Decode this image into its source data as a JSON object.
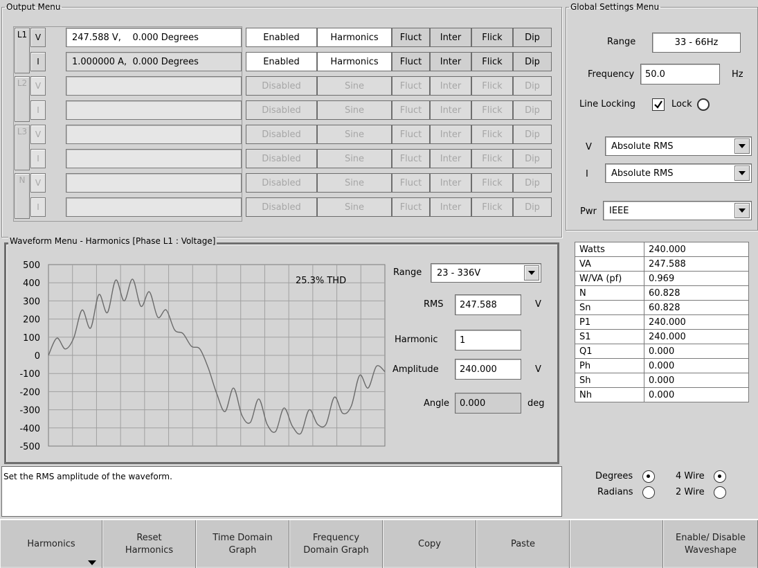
{
  "output_menu": {
    "title": "Output Menu",
    "groups": [
      {
        "phase": "L1",
        "enabled": true,
        "rows": [
          {
            "type": "V",
            "value": "247.588 V,    0.000 Degrees",
            "state": "Enabled",
            "mode": "Harmonics"
          },
          {
            "type": "I",
            "value": "1.000000 A,  0.000 Degrees",
            "state": "Enabled",
            "mode": "Harmonics"
          }
        ]
      },
      {
        "phase": "L2",
        "enabled": false,
        "rows": [
          {
            "type": "V",
            "value": "",
            "state": "Disabled",
            "mode": "Sine"
          },
          {
            "type": "I",
            "value": "",
            "state": "Disabled",
            "mode": "Sine"
          }
        ]
      },
      {
        "phase": "L3",
        "enabled": false,
        "rows": [
          {
            "type": "V",
            "value": "",
            "state": "Disabled",
            "mode": "Sine"
          },
          {
            "type": "I",
            "value": "",
            "state": "Disabled",
            "mode": "Sine"
          }
        ]
      },
      {
        "phase": "N",
        "enabled": false,
        "rows": [
          {
            "type": "V",
            "value": "",
            "state": "Disabled",
            "mode": "Sine"
          },
          {
            "type": "I",
            "value": "",
            "state": "Disabled",
            "mode": "Sine"
          }
        ]
      }
    ],
    "row_buttons": [
      "Fluct",
      "Inter",
      "Flick",
      "Dip"
    ]
  },
  "waveform_menu": {
    "title": "Waveform Menu - Harmonics [Phase L1 : Voltage]",
    "thd_label": "25.3% THD",
    "range_label": "Range",
    "range_value": "23 - 336V",
    "rms_label": "RMS",
    "rms_value": "247.588",
    "rms_unit": "V",
    "harmonic_label": "Harmonic",
    "harmonic_value": "1",
    "amplitude_label": "Amplitude",
    "amplitude_value": "240.000",
    "amplitude_unit": "V",
    "angle_label": "Angle",
    "angle_value": "0.000",
    "angle_unit": "deg"
  },
  "chart_data": {
    "type": "line",
    "title": "",
    "annotation": "25.3% THD",
    "xlabel": "",
    "ylabel": "",
    "ylim": [
      -500,
      500
    ],
    "y_ticks": [
      "500",
      "400",
      "300",
      "200",
      "100",
      "0",
      "-100",
      "-200",
      "-300",
      "-400",
      "-500"
    ],
    "grid": true,
    "series": [
      {
        "x": [
          0,
          0.025,
          0.05,
          0.075,
          0.1,
          0.125,
          0.15,
          0.175,
          0.2,
          0.225,
          0.25,
          0.275,
          0.3,
          0.325,
          0.35,
          0.375,
          0.4,
          0.425,
          0.45,
          0.475,
          0.5,
          0.525,
          0.55,
          0.575,
          0.6,
          0.625,
          0.65,
          0.675,
          0.7,
          0.725,
          0.75,
          0.775,
          0.8,
          0.825,
          0.85,
          0.875,
          0.9,
          0.925,
          0.95,
          0.975,
          1
        ],
        "values": [
          0,
          95,
          35,
          95,
          250,
          150,
          335,
          235,
          415,
          300,
          420,
          270,
          350,
          210,
          250,
          140,
          120,
          50,
          35,
          -70,
          -210,
          -310,
          -180,
          -330,
          -370,
          -240,
          -380,
          -420,
          -290,
          -390,
          -430,
          -300,
          -380,
          -380,
          -230,
          -320,
          -280,
          -110,
          -180,
          -60,
          -90
        ]
      }
    ]
  },
  "status": {
    "message": "Set the RMS amplitude of the waveform."
  },
  "global_settings": {
    "title": "Global Settings Menu",
    "range_label": "Range",
    "range_value": "33 - 66Hz",
    "frequency_label": "Frequency",
    "frequency_value": "50.0",
    "frequency_unit": "Hz",
    "line_locking_label": "Line Locking",
    "lock_label": "Lock",
    "v_label": "V",
    "v_mode": "Absolute RMS",
    "i_label": "I",
    "i_mode": "Absolute RMS",
    "pwr_label": "Pwr",
    "pwr_mode": "IEEE",
    "measurements": [
      {
        "name": "Watts",
        "value": "240.000"
      },
      {
        "name": "VA",
        "value": "247.588"
      },
      {
        "name": "W/VA (pf)",
        "value": "0.969"
      },
      {
        "name": "N",
        "value": "60.828"
      },
      {
        "name": "Sn",
        "value": "60.828"
      },
      {
        "name": "P1",
        "value": "240.000"
      },
      {
        "name": "S1",
        "value": "240.000"
      },
      {
        "name": "Q1",
        "value": "0.000"
      },
      {
        "name": "Ph",
        "value": "0.000"
      },
      {
        "name": "Sh",
        "value": "0.000"
      },
      {
        "name": "Nh",
        "value": "0.000"
      }
    ],
    "degrees_label": "Degrees",
    "radians_label": "Radians",
    "wire4_label": "4 Wire",
    "wire2_label": "2 Wire"
  },
  "toolbar": {
    "harmonics": "Harmonics",
    "reset_l1": "Reset",
    "reset_l2": "Harmonics",
    "time_l1": "Time Domain",
    "time_l2": "Graph",
    "freq_l1": "Frequency",
    "freq_l2": "Domain Graph",
    "copy": "Copy",
    "paste": "Paste",
    "enable_l1": "Enable/ Disable",
    "enable_l2": "Waveshape"
  }
}
